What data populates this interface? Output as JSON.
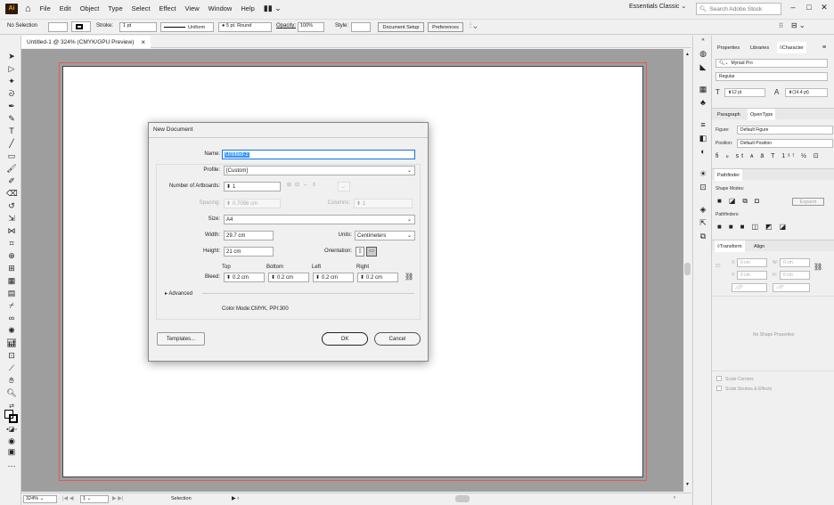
{
  "menubar": {
    "logo": "Ai",
    "items": [
      "File",
      "Edit",
      "Object",
      "Type",
      "Select",
      "Effect",
      "View",
      "Window",
      "Help"
    ],
    "workspace": "Essentials Classic",
    "search_placeholder": "Search Adobe Stock"
  },
  "control": {
    "selection": "No Selection",
    "stroke_label": "Stroke:",
    "stroke_value": "1 pt",
    "uniform": "Uniform",
    "brush": "5 pt. Round",
    "opacity_label": "Opacity:",
    "opacity_value": "100%",
    "style_label": "Style:",
    "document_setup": "Document Setup",
    "preferences": "Preferences"
  },
  "document_tab": {
    "title": "Untitled-1 @ 324% (CMYK/GPU Preview)",
    "close": "×"
  },
  "statusbar": {
    "zoom": "324%",
    "artboard": "1",
    "tool": "Selection"
  },
  "dialog": {
    "title": "New Document",
    "name_label": "Name:",
    "name_value": "Untitled-2",
    "profile_label": "Profile:",
    "profile_value": "[Custom]",
    "artboards_label": "Number of Artboards:",
    "artboards_value": "1",
    "spacing_label": "Spacing:",
    "spacing_value": "0.7056 cm",
    "columns_label": "Columns:",
    "columns_value": "1",
    "size_label": "Size:",
    "size_value": "A4",
    "width_label": "Width:",
    "width_value": "29.7 cm",
    "units_label": "Units:",
    "units_value": "Centimeters",
    "height_label": "Height:",
    "height_value": "21 cm",
    "orientation_label": "Orientation:",
    "bleed_label": "Bleed:",
    "bleed_top_label": "Top",
    "bleed_bottom_label": "Bottom",
    "bleed_left_label": "Left",
    "bleed_right_label": "Right",
    "bleed_top": "0.2 cm",
    "bleed_bottom": "0.2 cm",
    "bleed_left": "0.2 cm",
    "bleed_right": "0.2 cm",
    "advanced": "Advanced",
    "color_mode": "Color Mode:CMYK, PPI:300",
    "templates": "Templates...",
    "ok": "OK",
    "cancel": "Cancel"
  },
  "panel": {
    "tabs": [
      "Properties",
      "Libraries",
      "Character"
    ],
    "font": "Myriad Pro",
    "font_style": "Regular",
    "font_size": "12 pt",
    "leading": "(14.4 pt)",
    "tabs2": [
      "Paragraph",
      "OpenType"
    ],
    "figure_label": "Figure:",
    "figure_value": "Default Figure",
    "position_label": "Position:",
    "position_value": "Default Position",
    "pathfinder_tab": "Pathfinder",
    "shape_modes": "Shape Modes:",
    "expand": "Expand",
    "pathfinders": "Pathfinders:",
    "transform_tab": "Transform",
    "align_tab": "Align",
    "x_label": "X:",
    "x_value": "0 cm",
    "w_label": "W:",
    "w_value": "0 cm",
    "y_label": "Y:",
    "y_value": "0 cm",
    "h_label": "H:",
    "h_value": "0 cm",
    "angle_value": "0°",
    "shear_value": "0°",
    "no_shape": "No Shape Properties",
    "scale_corners": "Scale Corners",
    "scale_strokes": "Scale Strokes & Effects"
  },
  "colors": {
    "artboard_border": "#e05a5a",
    "canvas": "#9e9e9e",
    "accent": "#1473e6"
  }
}
